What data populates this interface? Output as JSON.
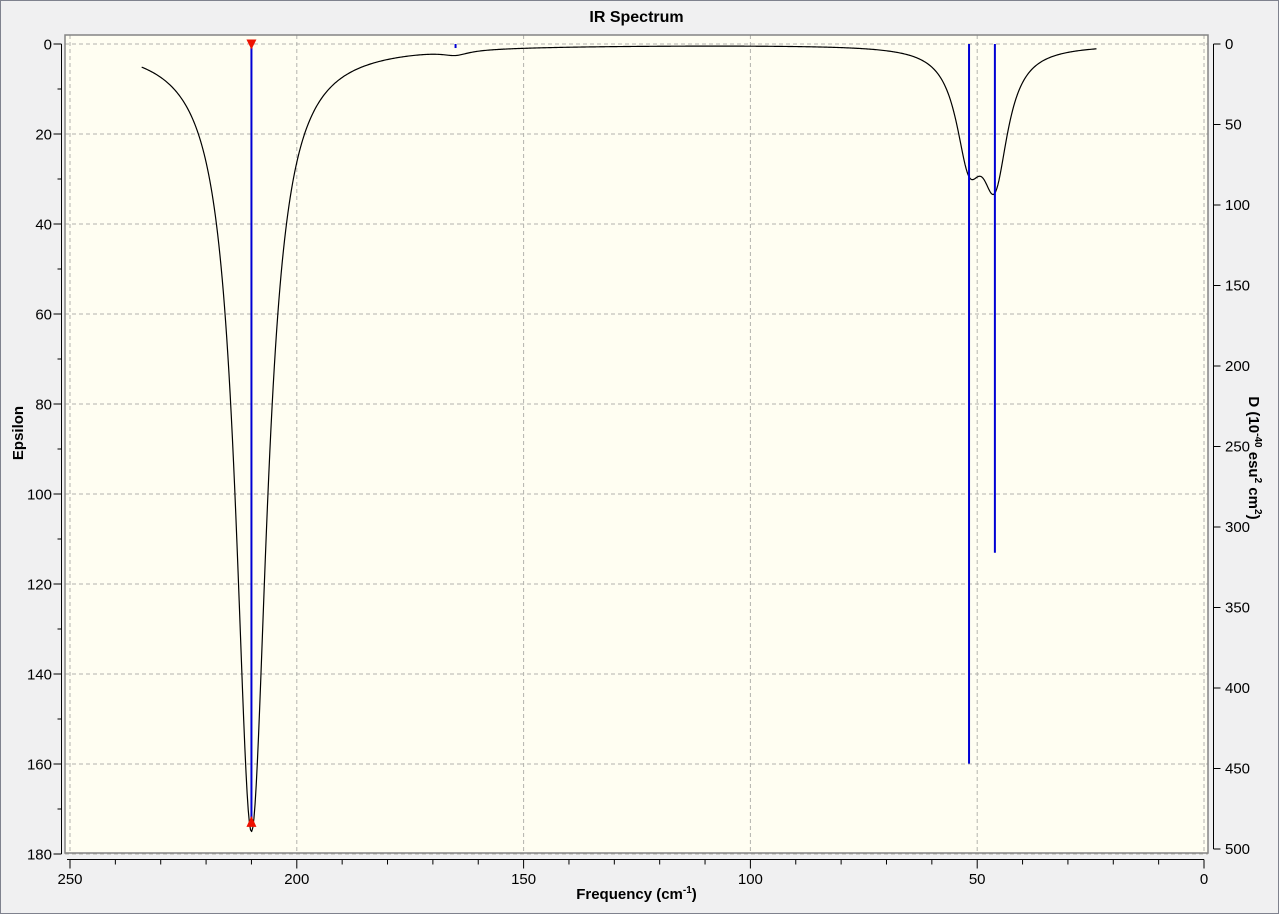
{
  "window": {
    "title": "IR Spectrum"
  },
  "chart_data": {
    "type": "line",
    "title": "IR Spectrum",
    "grid": true,
    "legend": false,
    "x_axis": {
      "label_parts": {
        "p1": "Frequency (cm",
        "s1": "-1",
        "p2": ")"
      },
      "min": 0,
      "max": 250,
      "reversed": true,
      "major_step": 50,
      "minor_step": 10,
      "tick_labels": [
        "250",
        "200",
        "150",
        "100",
        "50",
        "0"
      ]
    },
    "y_left": {
      "label": "Epsilon",
      "min": 0,
      "max": 180,
      "inverted": true,
      "major_step": 20,
      "minor_step": 10,
      "tick_labels": [
        "0",
        "20",
        "40",
        "60",
        "80",
        "100",
        "120",
        "140",
        "160",
        "180"
      ]
    },
    "y_right": {
      "label_parts": {
        "p1": "D (10",
        "s1": "-40",
        "p2": " esu",
        "s2": "2",
        "p3": " cm",
        "s3": "2",
        "p4": ")"
      },
      "min": 0,
      "max": 500,
      "major_step": 50,
      "tick_labels": [
        "0",
        "50",
        "100",
        "150",
        "200",
        "250",
        "300",
        "350",
        "400",
        "450",
        "500"
      ]
    },
    "sticks": [
      {
        "frequency": 210.0,
        "D": 481,
        "selected": true
      },
      {
        "frequency": 165.0,
        "D": 2.5,
        "selected": false
      },
      {
        "frequency": 51.8,
        "D": 447,
        "selected": false
      },
      {
        "frequency": 46.1,
        "D": 316,
        "selected": false
      }
    ],
    "curve_lorentzians": [
      {
        "center": 210.0,
        "epsilon_max": 175.0,
        "hwhm": 4.2
      },
      {
        "center": 165.0,
        "epsilon_max": 1.0,
        "hwhm": 3.5
      },
      {
        "center": 51.8,
        "epsilon_max": 22.0,
        "hwhm": 3.5
      },
      {
        "center": 46.1,
        "epsilon_max": 27.0,
        "hwhm": 3.5
      }
    ],
    "curve_domain": [
      23.5,
      234.2
    ],
    "colors": {
      "curve": "#000000",
      "stick": "#0000d4",
      "marker": "#ee1100",
      "canvas_bg": "#fffef2",
      "outer_bg": "#f0f0f1",
      "grid": "#b3b3ad",
      "frame": "#848484",
      "axis": "#000000",
      "border": "#7f828e"
    }
  }
}
